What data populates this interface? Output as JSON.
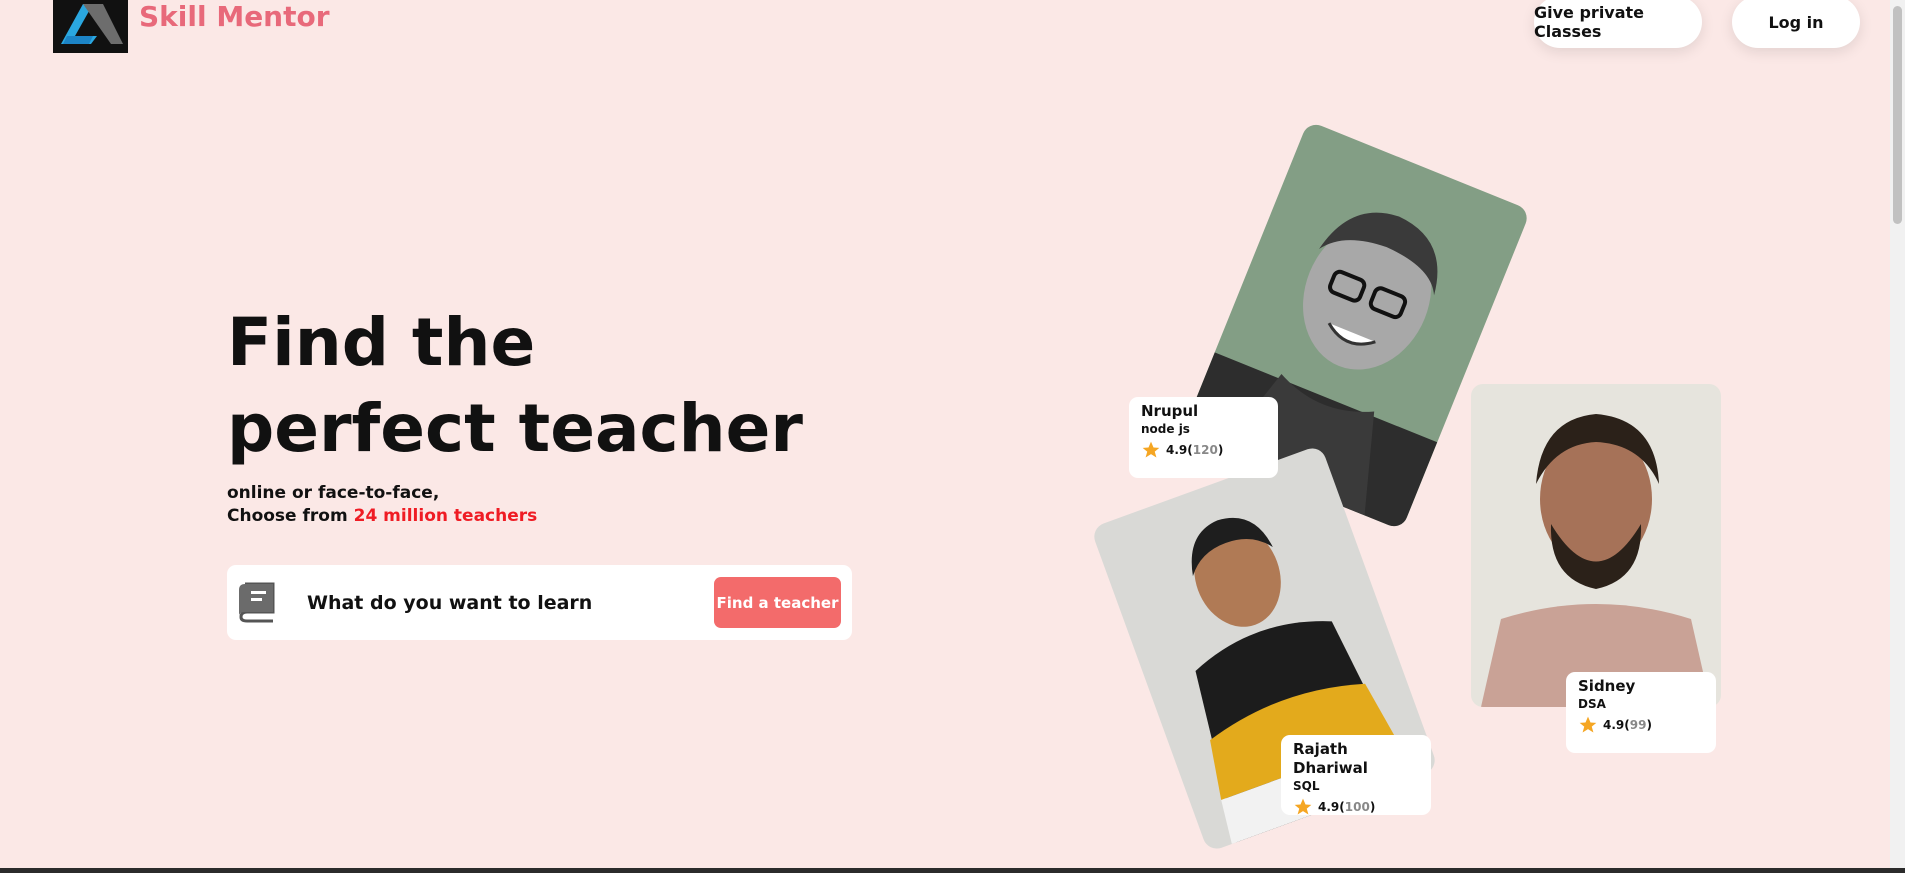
{
  "header": {
    "brand": "Skill Mentor",
    "give_classes_label": "Give private Classes",
    "login_label": "Log in"
  },
  "hero": {
    "title_line1": "Find the",
    "title_line2": "perfect teacher",
    "subtitle_line1": "online or face-to-face,",
    "subtitle_prefix": "Choose from ",
    "subtitle_highlight": "24 million teachers"
  },
  "search": {
    "placeholder": "What do you want to learn",
    "button_label": "Find a teacher"
  },
  "teachers": [
    {
      "name": "Nrupul",
      "subject": "node js",
      "rating": "4.9",
      "count": "120"
    },
    {
      "name": "Rajath Dhariwal",
      "subject": "SQL",
      "rating": "4.9",
      "count": "100"
    },
    {
      "name": "Sidney",
      "subject": "DSA",
      "rating": "4.9",
      "count": "99"
    }
  ],
  "colors": {
    "background": "#fbe8e6",
    "brand": "#e8697a",
    "accent_button": "#f36b6b",
    "highlight": "#ef1c24",
    "star": "#f5a623"
  },
  "icons": {
    "logo": "skill-mentor-logo",
    "search": "book-icon",
    "rating": "star-icon"
  }
}
